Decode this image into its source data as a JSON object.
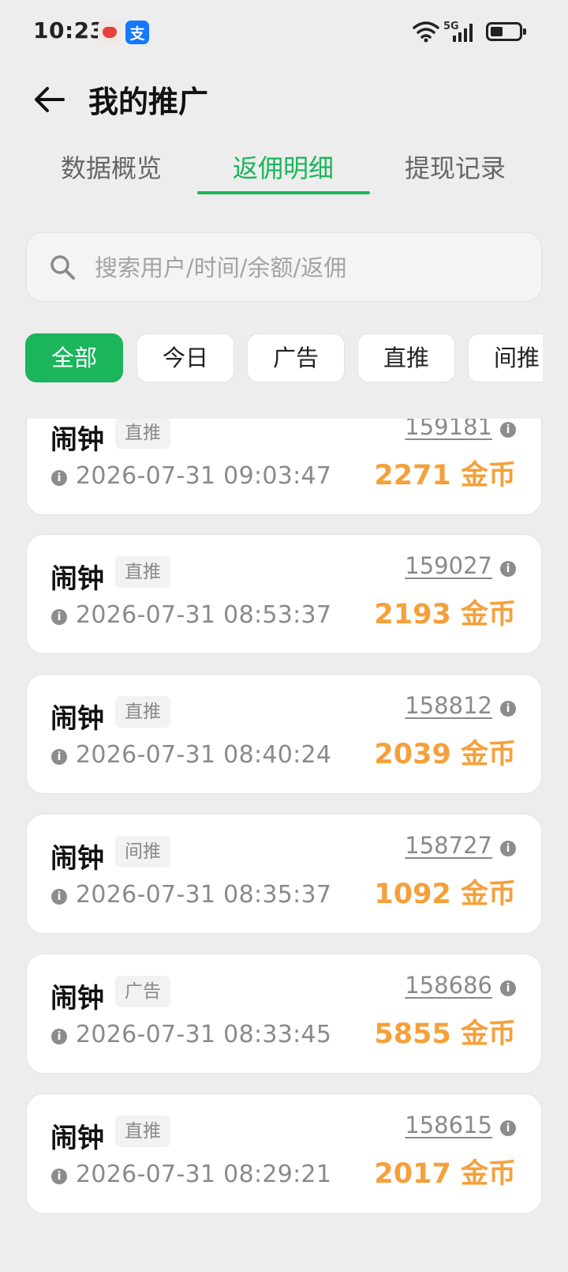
{
  "status_bar": {
    "time": "10:23",
    "alipay_badge": "支",
    "network": "5G"
  },
  "header": {
    "title": "我的推广"
  },
  "tabs": [
    {
      "label": "数据概览",
      "active": false
    },
    {
      "label": "返佣明细",
      "active": true
    },
    {
      "label": "提现记录",
      "active": false
    }
  ],
  "search": {
    "placeholder": "搜索用户/时间/余额/返佣",
    "value": ""
  },
  "filters": [
    {
      "label": "全部",
      "active": true
    },
    {
      "label": "今日",
      "active": false
    },
    {
      "label": "广告",
      "active": false
    },
    {
      "label": "直推",
      "active": false
    },
    {
      "label": "间推",
      "active": false
    }
  ],
  "records": [
    {
      "name": "闹钟",
      "tag": "直推",
      "time": "2026-07-31 09:03:47",
      "id": "159181",
      "amount": "2271 金币"
    },
    {
      "name": "闹钟",
      "tag": "直推",
      "time": "2026-07-31 08:53:37",
      "id": "159027",
      "amount": "2193 金币"
    },
    {
      "name": "闹钟",
      "tag": "直推",
      "time": "2026-07-31 08:40:24",
      "id": "158812",
      "amount": "2039 金币"
    },
    {
      "name": "闹钟",
      "tag": "间推",
      "time": "2026-07-31 08:35:37",
      "id": "158727",
      "amount": "1092 金币"
    },
    {
      "name": "闹钟",
      "tag": "广告",
      "time": "2026-07-31 08:33:45",
      "id": "158686",
      "amount": "5855 金币"
    },
    {
      "name": "闹钟",
      "tag": "直推",
      "time": "2026-07-31 08:29:21",
      "id": "158615",
      "amount": "2017 金币"
    }
  ],
  "icons": {
    "back": "arrow-left-icon",
    "search": "search-icon",
    "info": "info-icon"
  },
  "colors": {
    "accent": "#1bb55c",
    "amount": "#f5a03a",
    "background": "#ededed"
  }
}
